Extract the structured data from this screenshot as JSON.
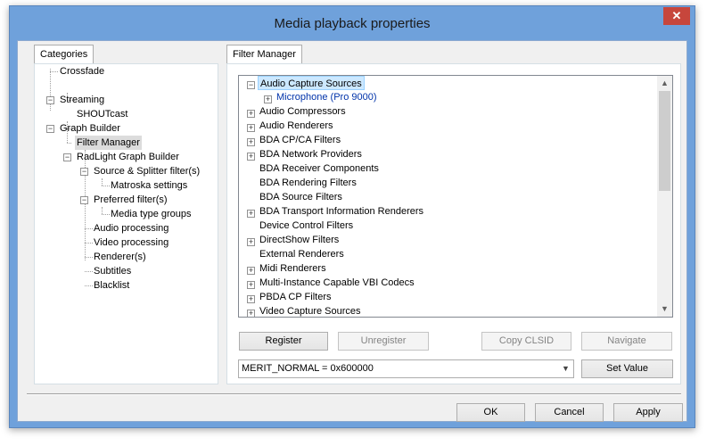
{
  "window": {
    "title": "Media playback properties",
    "close_glyph": "✕"
  },
  "categories": {
    "title": "Categories",
    "items": [
      "Crossfade",
      "Streaming",
      "SHOUTcast",
      "Graph Builder",
      "Filter Manager",
      "RadLight Graph Builder",
      "Source & Splitter filter(s)",
      "Matroska settings",
      "Preferred filter(s)",
      "Media type groups",
      "Audio processing",
      "Video processing",
      "Renderer(s)",
      "Subtitles",
      "Blacklist"
    ]
  },
  "filter_manager": {
    "title": "Filter Manager",
    "list": [
      "Audio Capture Sources",
      "Microphone (Pro 9000)",
      "Audio Compressors",
      "Audio Renderers",
      "BDA CP/CA Filters",
      "BDA Network Providers",
      "BDA Receiver Components",
      "BDA Rendering Filters",
      "BDA Source Filters",
      "BDA Transport Information Renderers",
      "Device Control Filters",
      "DirectShow Filters",
      "External Renderers",
      "Midi Renderers",
      "Multi-Instance Capable VBI Codecs",
      "PBDA CP Filters",
      "Video Capture Sources"
    ],
    "buttons": {
      "register": "Register",
      "unregister": "Unregister",
      "copy_clsid": "Copy CLSID",
      "navigate": "Navigate"
    },
    "merit": {
      "value": "MERIT_NORMAL = 0x600000",
      "set_value": "Set Value"
    }
  },
  "footer": {
    "ok": "OK",
    "cancel": "Cancel",
    "apply": "Apply"
  },
  "icons": {
    "expand": "expand-icon",
    "collapse": "collapse-icon",
    "scroll_up": "scroll-up-icon",
    "scroll_down": "scroll-down-icon",
    "dropdown": "chevron-down-icon",
    "close": "close-icon"
  }
}
